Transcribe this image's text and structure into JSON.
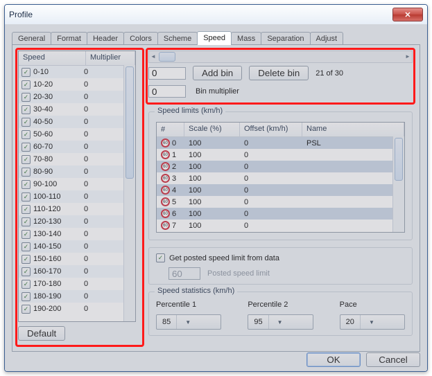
{
  "window": {
    "title": "Profile"
  },
  "tabs": [
    "General",
    "Format",
    "Header",
    "Colors",
    "Scheme",
    "Speed",
    "Mass",
    "Separation",
    "Adjust"
  ],
  "active_tab": 5,
  "speed_bins": {
    "columns": [
      "Speed",
      "Multiplier"
    ],
    "rows": [
      {
        "label": "0-10",
        "mult": "0"
      },
      {
        "label": "10-20",
        "mult": "0"
      },
      {
        "label": "20-30",
        "mult": "0"
      },
      {
        "label": "30-40",
        "mult": "0"
      },
      {
        "label": "40-50",
        "mult": "0"
      },
      {
        "label": "50-60",
        "mult": "0"
      },
      {
        "label": "60-70",
        "mult": "0"
      },
      {
        "label": "70-80",
        "mult": "0"
      },
      {
        "label": "80-90",
        "mult": "0"
      },
      {
        "label": "90-100",
        "mult": "0"
      },
      {
        "label": "100-110",
        "mult": "0"
      },
      {
        "label": "110-120",
        "mult": "0"
      },
      {
        "label": "120-130",
        "mult": "0"
      },
      {
        "label": "130-140",
        "mult": "0"
      },
      {
        "label": "140-150",
        "mult": "0"
      },
      {
        "label": "150-160",
        "mult": "0"
      },
      {
        "label": "160-170",
        "mult": "0"
      },
      {
        "label": "170-180",
        "mult": "0"
      },
      {
        "label": "180-190",
        "mult": "0"
      },
      {
        "label": "190-200",
        "mult": "0"
      }
    ],
    "default_btn": "Default"
  },
  "bin_controls": {
    "value_input": "0",
    "add_btn": "Add bin",
    "delete_btn": "Delete bin",
    "counter": "21 of 30",
    "mult_input": "0",
    "mult_label": "Bin multiplier"
  },
  "speed_limits": {
    "title": "Speed limits (km/h)",
    "columns": [
      "#",
      "Scale (%)",
      "Offset (km/h)",
      "Name"
    ],
    "rows": [
      {
        "n": "0",
        "scale": "100",
        "offset": "0",
        "name": "PSL"
      },
      {
        "n": "1",
        "scale": "100",
        "offset": "0",
        "name": ""
      },
      {
        "n": "2",
        "scale": "100",
        "offset": "0",
        "name": ""
      },
      {
        "n": "3",
        "scale": "100",
        "offset": "0",
        "name": ""
      },
      {
        "n": "4",
        "scale": "100",
        "offset": "0",
        "name": ""
      },
      {
        "n": "5",
        "scale": "100",
        "offset": "0",
        "name": ""
      },
      {
        "n": "6",
        "scale": "100",
        "offset": "0",
        "name": ""
      },
      {
        "n": "7",
        "scale": "100",
        "offset": "0",
        "name": ""
      }
    ]
  },
  "psl": {
    "checkbox_label": "Get posted speed limit from data",
    "value": "60",
    "value_label": "Posted speed limit"
  },
  "stats": {
    "title": "Speed statistics (km/h)",
    "p1_label": "Percentile 1",
    "p1_value": "85",
    "p2_label": "Percentile 2",
    "p2_value": "95",
    "pace_label": "Pace",
    "pace_value": "20"
  },
  "footer": {
    "ok": "OK",
    "cancel": "Cancel"
  }
}
